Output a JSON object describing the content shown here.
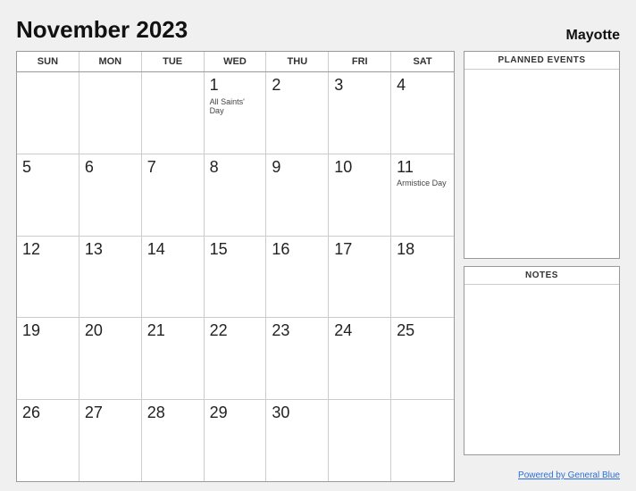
{
  "header": {
    "title": "November 2023",
    "region": "Mayotte"
  },
  "day_headers": [
    "SUN",
    "MON",
    "TUE",
    "WED",
    "THU",
    "FRI",
    "SAT"
  ],
  "weeks": [
    [
      {
        "num": "",
        "event": ""
      },
      {
        "num": "",
        "event": ""
      },
      {
        "num": "",
        "event": ""
      },
      {
        "num": "1",
        "event": "All Saints' Day"
      },
      {
        "num": "2",
        "event": ""
      },
      {
        "num": "3",
        "event": ""
      },
      {
        "num": "4",
        "event": ""
      }
    ],
    [
      {
        "num": "5",
        "event": ""
      },
      {
        "num": "6",
        "event": ""
      },
      {
        "num": "7",
        "event": ""
      },
      {
        "num": "8",
        "event": ""
      },
      {
        "num": "9",
        "event": ""
      },
      {
        "num": "10",
        "event": ""
      },
      {
        "num": "11",
        "event": "Armistice Day"
      }
    ],
    [
      {
        "num": "12",
        "event": ""
      },
      {
        "num": "13",
        "event": ""
      },
      {
        "num": "14",
        "event": ""
      },
      {
        "num": "15",
        "event": ""
      },
      {
        "num": "16",
        "event": ""
      },
      {
        "num": "17",
        "event": ""
      },
      {
        "num": "18",
        "event": ""
      }
    ],
    [
      {
        "num": "19",
        "event": ""
      },
      {
        "num": "20",
        "event": ""
      },
      {
        "num": "21",
        "event": ""
      },
      {
        "num": "22",
        "event": ""
      },
      {
        "num": "23",
        "event": ""
      },
      {
        "num": "24",
        "event": ""
      },
      {
        "num": "25",
        "event": ""
      }
    ],
    [
      {
        "num": "26",
        "event": ""
      },
      {
        "num": "27",
        "event": ""
      },
      {
        "num": "28",
        "event": ""
      },
      {
        "num": "29",
        "event": ""
      },
      {
        "num": "30",
        "event": ""
      },
      {
        "num": "",
        "event": ""
      },
      {
        "num": "",
        "event": ""
      }
    ]
  ],
  "sidebar": {
    "planned_events_label": "PLANNED EVENTS",
    "notes_label": "NOTES"
  },
  "footer": {
    "link_text": "Powered by General Blue"
  }
}
